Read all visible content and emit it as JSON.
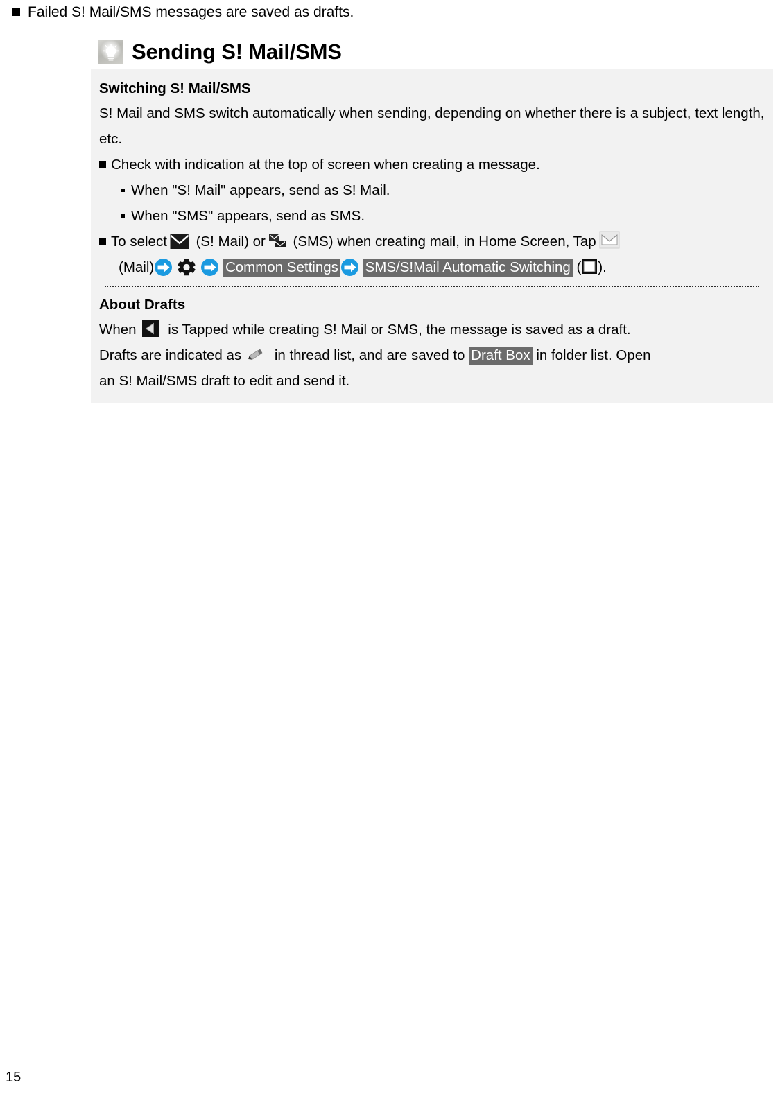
{
  "page": {
    "number": "15",
    "intro_note": "Failed S! Mail/SMS messages are saved as drafts."
  },
  "section": {
    "icon": "tip-bulb-icon",
    "title": "Sending S! Mail/SMS"
  },
  "blocks": [
    {
      "heading": "Switching S! Mail/SMS",
      "paragraph": "S! Mail and SMS switch automatically when sending, depending on whether there is a subject, text length, etc."
    },
    {
      "heading": "About Drafts"
    }
  ],
  "switching": {
    "heading": "Switching S! Mail/SMS",
    "paragraph": "S! Mail and SMS switch automatically when sending, depending on whether there is a subject, text length, etc.",
    "bullet_check": "Check with indication at the top of screen when creating a message.",
    "sub_bullet_1": "When \"S! Mail\" appears, send as S! Mail.",
    "sub_bullet_2": "When \"SMS\" appears, send as SMS.",
    "select_line": {
      "part1": "To select",
      "part2": "(S! Mail) or",
      "part3": "(SMS) when creating mail, in Home Screen, Tap",
      "mail_label": "(Mail)",
      "chip_common_settings": "Common Settings",
      "chip_auto_switching": "SMS/S!Mail Automatic Switching",
      "paren_open": "(",
      "paren_close": ")."
    }
  },
  "drafts": {
    "heading": "About Drafts",
    "line1_part1": "When",
    "line1_part2": "is Tapped while creating S! Mail or SMS, the message is saved as a draft.",
    "line2_part1": "Drafts are indicated as",
    "line2_part2": "in thread list, and are saved to",
    "chip_draft_box": "Draft Box",
    "line2_part3": "in folder list. Open",
    "line3": "an S! Mail/SMS draft to edit and send it."
  },
  "colors": {
    "panel_bg": "#f2f2f2",
    "chip_bg": "#6b6b6b",
    "chip_text": "#ffffff",
    "arrow_blue": "#1b9ae0",
    "text": "#000000"
  }
}
